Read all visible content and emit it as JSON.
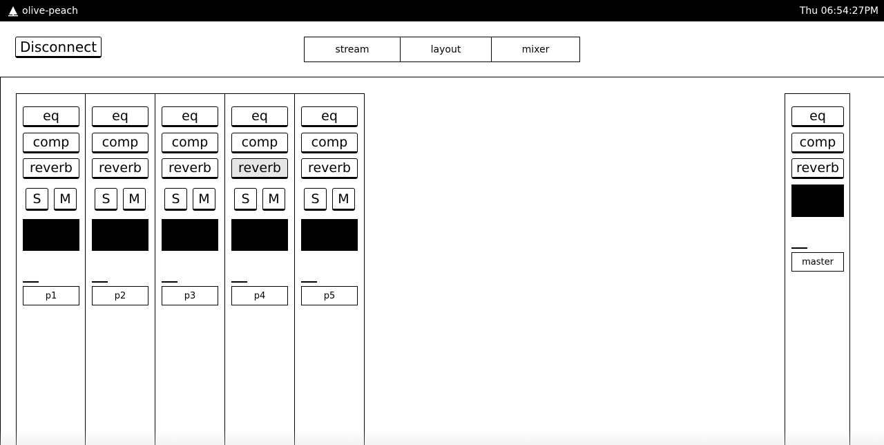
{
  "topbar": {
    "app_name": "olive-peach",
    "app_icon": "tree-icon",
    "clock": "Thu 06:54:27PM"
  },
  "header": {
    "disconnect_label": "Disconnect",
    "tabs": [
      {
        "label": "stream"
      },
      {
        "label": "layout"
      },
      {
        "label": "mixer"
      }
    ]
  },
  "strips": [
    {
      "eq": "eq",
      "comp": "comp",
      "reverb": "reverb",
      "solo": "S",
      "mute": "M",
      "name": "p1",
      "reverb_active": false
    },
    {
      "eq": "eq",
      "comp": "comp",
      "reverb": "reverb",
      "solo": "S",
      "mute": "M",
      "name": "p2",
      "reverb_active": false
    },
    {
      "eq": "eq",
      "comp": "comp",
      "reverb": "reverb",
      "solo": "S",
      "mute": "M",
      "name": "p3",
      "reverb_active": false
    },
    {
      "eq": "eq",
      "comp": "comp",
      "reverb": "reverb",
      "solo": "S",
      "mute": "M",
      "name": "p4",
      "reverb_active": true
    },
    {
      "eq": "eq",
      "comp": "comp",
      "reverb": "reverb",
      "solo": "S",
      "mute": "M",
      "name": "p5",
      "reverb_active": false
    }
  ],
  "master": {
    "eq": "eq",
    "comp": "comp",
    "reverb": "reverb",
    "name": "master"
  },
  "colors": {
    "bar_bg": "#000000",
    "active_button": "#e6e6e6"
  }
}
